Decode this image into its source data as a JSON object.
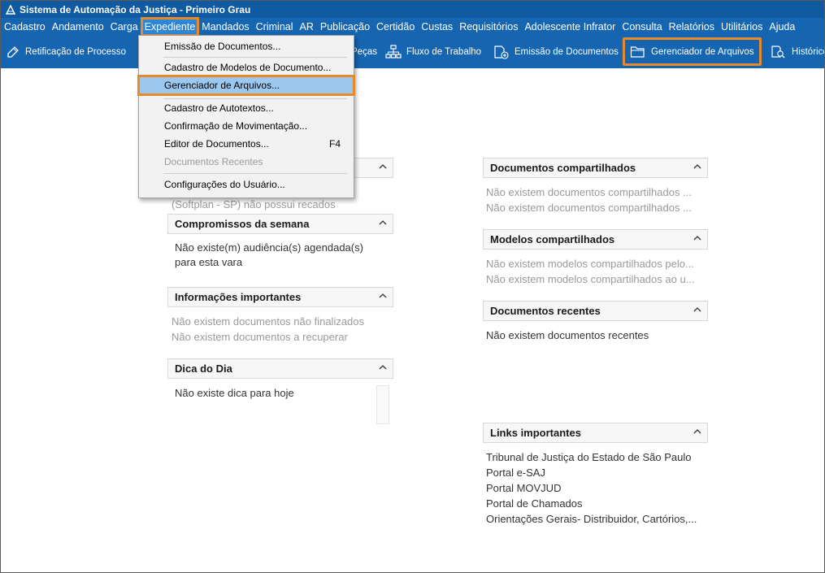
{
  "window": {
    "title": "Sistema de Automação da Justiça - Primeiro Grau"
  },
  "menubar": {
    "items": [
      "Cadastro",
      "Andamento",
      "Carga",
      "Expediente",
      "Mandados",
      "Criminal",
      "AR",
      "Publicação",
      "Certidão",
      "Custas",
      "Requisitórios",
      "Adolescente Infrator",
      "Consulta",
      "Relatórios",
      "Utilitários",
      "Ajuda"
    ],
    "active": "Expediente"
  },
  "toolbar": {
    "retificacao": "Retificação de Processo",
    "pecas": "Peças",
    "fluxo": "Fluxo de Trabalho",
    "emissao": "Emissão de Documentos",
    "gerenciador": "Gerenciador de Arquivos",
    "historico": "Histórico"
  },
  "dropdown": {
    "emissao": "Emissão de Documentos...",
    "cadastro_modelos": "Cadastro de Modelos de Documento...",
    "gerenciador": "Gerenciador de Arquivos...",
    "cadastro_autotextos": "Cadastro de Autotextos...",
    "confirmacao": "Confirmação de Movimentação...",
    "editor": "Editor de Documentos...",
    "editor_shortcut": "F4",
    "recentes": "Documentos Recentes",
    "configuracoes": "Configurações do Usuário..."
  },
  "left": {
    "recados_text": "(Softplan - SP) não possui recados",
    "compromissos": {
      "title": "Compromissos da semana",
      "line1": "Não existe(m) audiência(s) agendada(s)",
      "line2": "para esta vara"
    },
    "informacoes": {
      "title": "Informações importantes",
      "line1": "Não existem documentos não finalizados",
      "line2": "Não existem documentos a recuperar"
    },
    "dica": {
      "title": "Dica do Dia",
      "line1": "Não existe dica para hoje"
    }
  },
  "right": {
    "compartilhados": {
      "title": "Documentos compartilhados",
      "line1": "Não existem documentos compartilhados ...",
      "line2": "Não existem documentos compartilhados ..."
    },
    "modelos": {
      "title": "Modelos compartilhados",
      "line1": "Não existem modelos compartilhados pelo...",
      "line2": "Não existem modelos compartilhados ao u..."
    },
    "recentes": {
      "title": "Documentos recentes",
      "line1": "Não existem documentos recentes"
    },
    "links": {
      "title": "Links importantes",
      "items": [
        "Tribunal de Justiça do Estado de São Paulo",
        "Portal e-SAJ",
        "Portal MOVJUD",
        "Portal de Chamados",
        "Orientações Gerais- Distribuidor, Cartórios,..."
      ]
    }
  },
  "colors": {
    "titlebar": "#0f5aa0",
    "menubar": "#1565b0",
    "highlight_outline": "#e88a2a",
    "menu_selected": "#9cc8ef"
  }
}
